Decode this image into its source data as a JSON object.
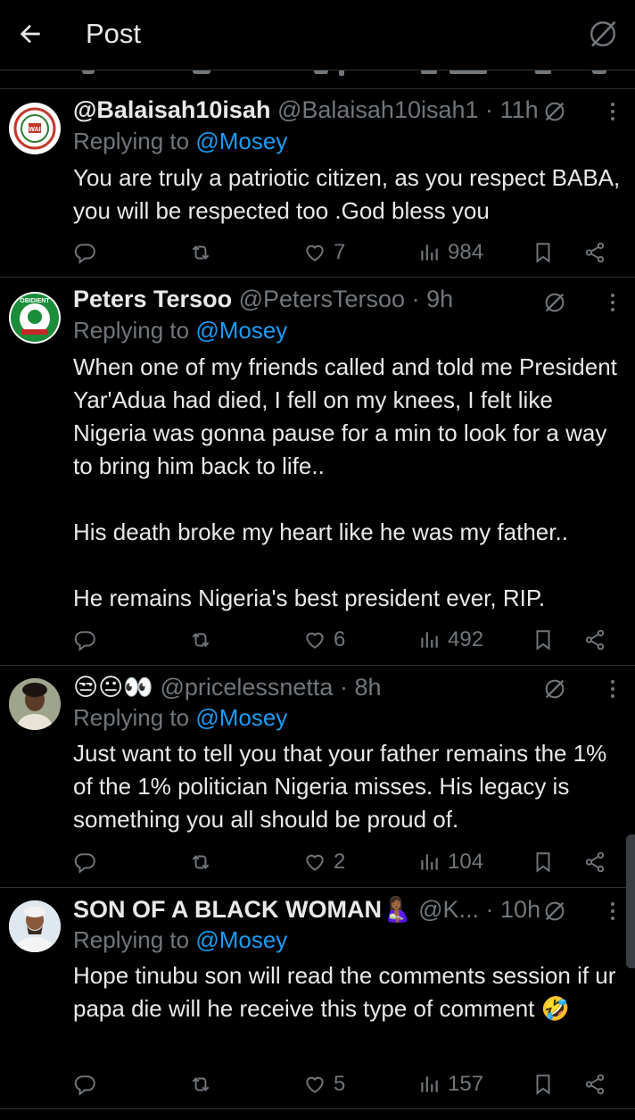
{
  "header": {
    "title": "Post"
  },
  "tweets": [
    {
      "display_name": "@Balaisah10isah",
      "handle": "@Balaisah10isah1",
      "time": "· 11h",
      "replying_prefix": "Replying to ",
      "replying_to": "@Mosey",
      "text": "You are truly a patriotic citizen, as you respect BABA, you will be respected too .God bless you",
      "likes": "7",
      "views": "984"
    },
    {
      "display_name": "Peters Tersoo",
      "handle": "@PetersTersoo",
      "time": "· 9h",
      "replying_prefix": "Replying to ",
      "replying_to": "@Mosey",
      "text": "When one of my friends called and told me President Yar'Adua had died, I fell on my knees, I felt like Nigeria was gonna pause for a min to look for a way to bring him back to life..\n\nHis death broke my heart like he was my father..\n\nHe remains Nigeria's best president ever, RIP.",
      "likes": "6",
      "views": "492"
    },
    {
      "display_name": "😒😐👀",
      "handle": "@pricelessnetta",
      "time": "· 8h",
      "replying_prefix": "Replying to ",
      "replying_to": "@Mosey",
      "text": "Just want to tell you that your father remains the 1% of the 1% politician Nigeria misses. His legacy is something you all should be proud of.",
      "likes": "2",
      "views": "104"
    },
    {
      "display_name": "SON OF A BLACK WOMAN🤱🏾",
      "handle": "@K...",
      "time": "· 10h",
      "replying_prefix": "Replying to ",
      "replying_to": "@Mosey",
      "text": "Hope tinubu son will read the comments session if ur papa die will he receive this type of comment 🤣",
      "likes": "5",
      "views": "157"
    }
  ],
  "colors": {
    "background": "#000000",
    "text": "#e7e9ea",
    "muted": "#71767b",
    "accent": "#1d9bf0",
    "divider": "#2f3336"
  },
  "icons": [
    "back-arrow-icon",
    "grok-icon",
    "more-dots-icon",
    "reply-icon",
    "repost-icon",
    "like-icon",
    "views-icon",
    "bookmark-icon",
    "share-icon"
  ]
}
